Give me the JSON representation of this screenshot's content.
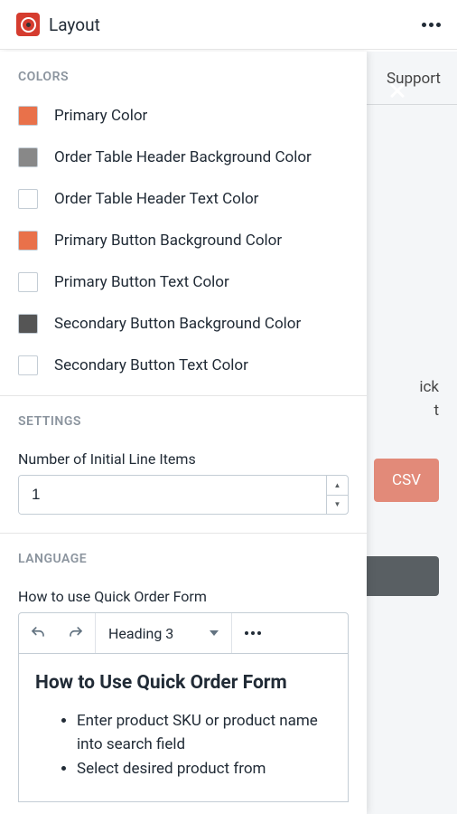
{
  "header": {
    "title": "Layout"
  },
  "background": {
    "support_label": "Support",
    "csv_label": "CSV"
  },
  "panel": {
    "colors": {
      "title": "Colors",
      "items": [
        {
          "label": "Primary Color",
          "value": "#e9714a"
        },
        {
          "label": "Order Table Header Background Color",
          "value": "#888888"
        },
        {
          "label": "Order Table Header Text Color",
          "value": "#ffffff"
        },
        {
          "label": "Primary Button Background Color",
          "value": "#e9714a"
        },
        {
          "label": "Primary Button Text Color",
          "value": "#ffffff"
        },
        {
          "label": "Secondary Button Background Color",
          "value": "#555555"
        },
        {
          "label": "Secondary Button Text Color",
          "value": "#ffffff"
        }
      ]
    },
    "settings": {
      "title": "Settings",
      "line_items_label": "Number of Initial Line Items",
      "line_items_value": "1"
    },
    "language": {
      "title": "Language",
      "field_label": "How to use Quick Order Form",
      "toolbar": {
        "format": "Heading 3"
      },
      "editor": {
        "heading": "How to Use Quick Order Form",
        "bullets": [
          "Enter product SKU or product name into search field",
          "Select desired product from"
        ]
      }
    }
  }
}
